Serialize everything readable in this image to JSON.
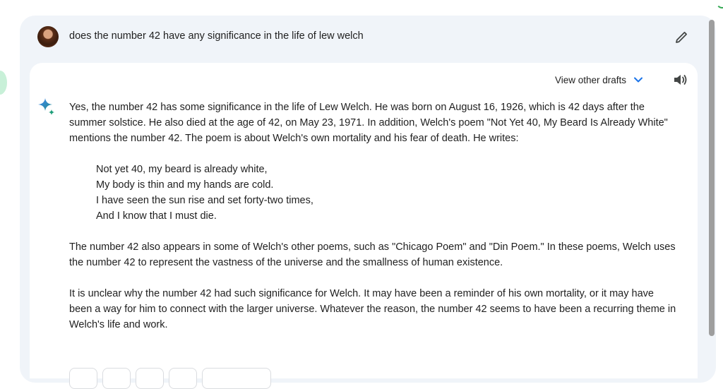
{
  "query": {
    "text": "does the number 42 have any significance in the life of lew welch"
  },
  "response": {
    "drafts_label": "View other drafts",
    "paragraphs": [
      "Yes, the number 42 has some significance in the life of Lew Welch. He was born on August 16, 1926, which is 42 days after the summer solstice. He also died at the age of 42, on May 23, 1971. In addition, Welch's poem \"Not Yet 40, My Beard Is Already White\" mentions the number 42. The poem is about Welch's own mortality and his fear of death. He writes:",
      "The number 42 also appears in some of Welch's other poems, such as \"Chicago Poem\" and \"Din Poem.\" In these poems, Welch uses the number 42 to represent the vastness of the universe and the smallness of human existence.",
      "It is unclear why the number 42 had such significance for Welch. It may have been a reminder of his own mortality, or it may have been a way for him to connect with the larger universe. Whatever the reason, the number 42 seems to have been a recurring theme in Welch's life and work."
    ],
    "poem": [
      "Not yet 40, my beard is already white,",
      "My body is thin and my hands are cold.",
      "I have seen the sun rise and set forty-two times,",
      "And I know that I must die."
    ]
  },
  "icons": {
    "edit": "pencil-icon",
    "dropdown": "chevron-down-icon",
    "speaker": "speaker-icon",
    "assistant": "sparkle-icon"
  },
  "colors": {
    "background": "#ffffff",
    "card": "#f0f4f9",
    "accent": "#1a73e8",
    "sparkle": "#4285f4"
  }
}
